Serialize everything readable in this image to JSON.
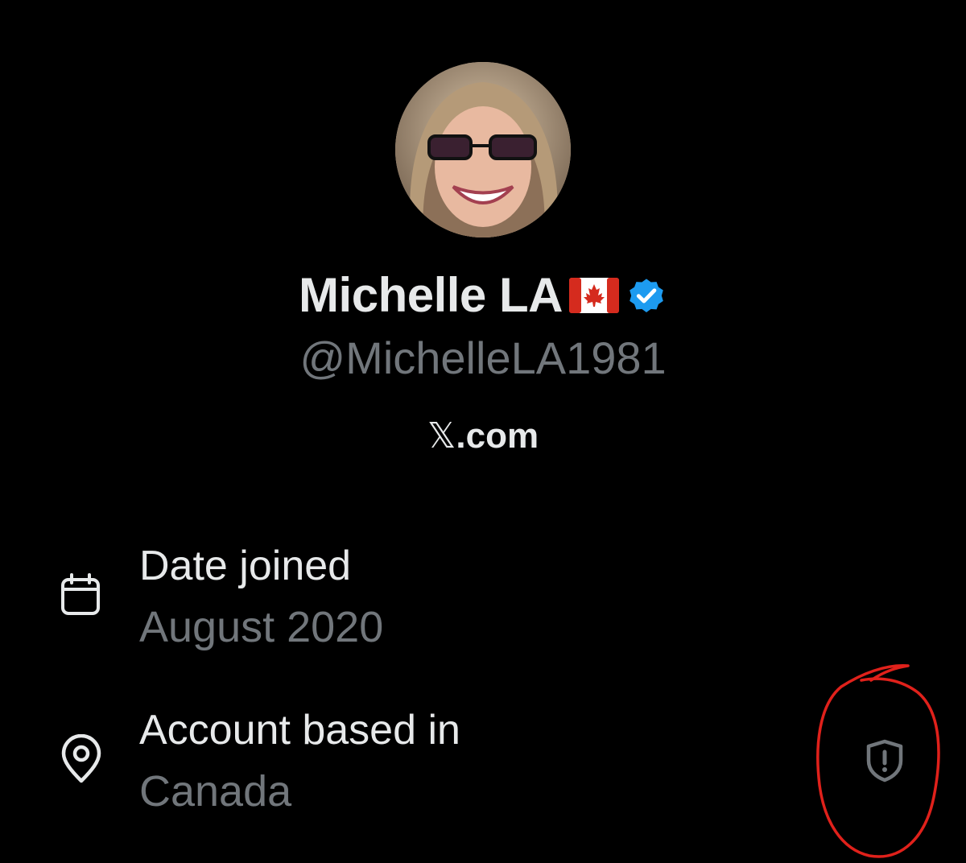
{
  "profile": {
    "display_name": "Michelle LA",
    "flag": "canada-flag-icon",
    "verified": true,
    "handle": "@MichelleLA1981",
    "site_prefix": "𝕏",
    "site_suffix": ".com"
  },
  "about": {
    "date_joined": {
      "icon": "calendar-icon",
      "label": "Date joined",
      "value": "August 2020"
    },
    "account_based_in": {
      "icon": "location-pin-icon",
      "label": "Account based in",
      "value": "Canada",
      "action_icon": "shield-alert-icon"
    }
  },
  "colors": {
    "background": "#000000",
    "primary_text": "#e7e9ea",
    "secondary_text": "#71767b",
    "verified_badge": "#1d9bf0",
    "annotation": "#e0211b"
  }
}
